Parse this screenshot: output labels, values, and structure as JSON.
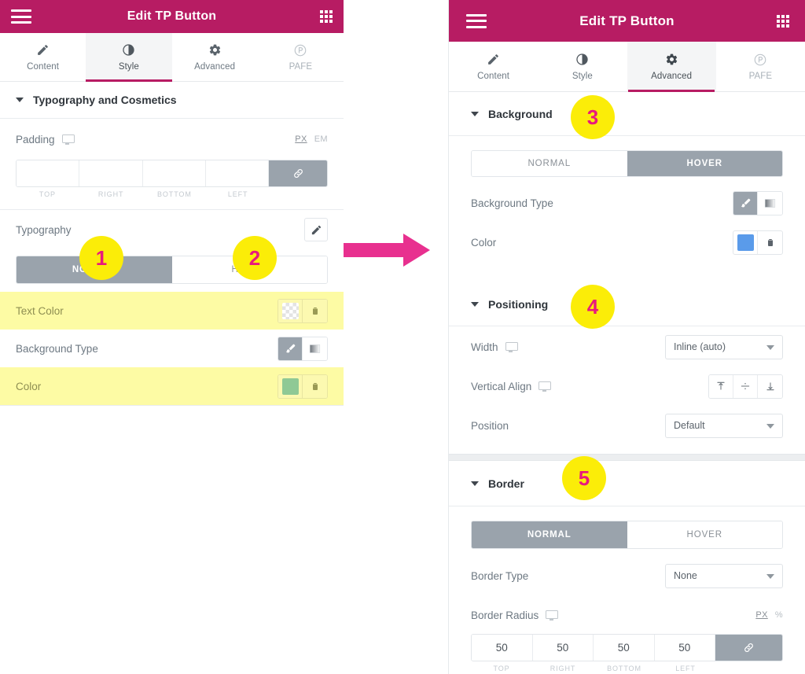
{
  "left_panel": {
    "titlebar": {
      "title": "Edit TP Button",
      "menu_icon": "hamburger-icon",
      "grid_icon": "apps-grid-icon"
    },
    "tabs": [
      {
        "label": "Content",
        "icon": "pencil-icon",
        "active": false
      },
      {
        "label": "Style",
        "icon": "contrast-icon",
        "active": true
      },
      {
        "label": "Advanced",
        "icon": "gear-icon",
        "active": false
      },
      {
        "label": "PAFE",
        "icon": "pafe-circle-p-icon",
        "active": false
      }
    ],
    "section": {
      "title": "Typography and Cosmetics"
    },
    "padding": {
      "label": "Padding",
      "units": [
        "PX",
        "EM"
      ],
      "active_unit": "PX",
      "values": [
        "",
        "",
        "",
        ""
      ],
      "captions": [
        "TOP",
        "RIGHT",
        "BOTTOM",
        "LEFT"
      ],
      "link_icon": "link-icon"
    },
    "typography": {
      "label": "Typography",
      "edit_icon": "pencil-edit-icon"
    },
    "state_toggle": {
      "options": [
        "NORMAL",
        "HOVER"
      ],
      "selected": "NORMAL"
    },
    "rows": [
      {
        "label": "Text Color",
        "control": "color",
        "swatch": "transparent",
        "reset_icon": "reset-icon",
        "highlighted": true
      },
      {
        "label": "Background Type",
        "control": "segmented",
        "options": [
          "classic-brush-icon",
          "gradient-icon"
        ],
        "selected": "classic-brush-icon",
        "highlighted": false
      },
      {
        "label": "Color",
        "control": "color",
        "swatch": "#8fc995",
        "reset_icon": "reset-icon",
        "highlighted": true
      }
    ]
  },
  "arrow": {
    "name": "flow-arrow",
    "color": "#e8308f"
  },
  "right_panel": {
    "titlebar": {
      "title": "Edit TP Button",
      "menu_icon": "hamburger-icon",
      "grid_icon": "apps-grid-icon"
    },
    "tabs": [
      {
        "label": "Content",
        "icon": "pencil-icon",
        "active": false
      },
      {
        "label": "Style",
        "icon": "contrast-icon",
        "active": false
      },
      {
        "label": "Advanced",
        "icon": "gear-icon",
        "active": true
      },
      {
        "label": "PAFE",
        "icon": "pafe-circle-p-icon",
        "active": false
      }
    ],
    "background_section": {
      "title": "Background",
      "badge": "3",
      "state_toggle": {
        "options": [
          "NORMAL",
          "HOVER"
        ],
        "selected": "HOVER"
      },
      "rows": [
        {
          "label": "Background Type",
          "control": "segmented",
          "options": [
            "classic-brush-icon",
            "gradient-icon"
          ],
          "selected": "classic-brush-icon"
        },
        {
          "label": "Color",
          "control": "color",
          "swatch": "#5a9bea",
          "reset_icon": "reset-icon"
        }
      ]
    },
    "positioning_section": {
      "title": "Positioning",
      "badge": "4",
      "width": {
        "label": "Width",
        "value": "Inline (auto)"
      },
      "vertical_align": {
        "label": "Vertical Align",
        "options": [
          "align-top-icon",
          "align-middle-icon",
          "align-bottom-icon"
        ],
        "selected": ""
      },
      "position": {
        "label": "Position",
        "value": "Default"
      }
    },
    "border_section": {
      "title": "Border",
      "badge": "5",
      "state_toggle": {
        "options": [
          "NORMAL",
          "HOVER"
        ],
        "selected": "NORMAL"
      },
      "border_type": {
        "label": "Border Type",
        "value": "None"
      },
      "border_radius": {
        "label": "Border Radius",
        "units": [
          "PX",
          "%"
        ],
        "active_unit": "PX",
        "values": [
          "50",
          "50",
          "50",
          "50"
        ],
        "captions": [
          "TOP",
          "RIGHT",
          "BOTTOM",
          "LEFT"
        ],
        "link_icon": "link-icon"
      }
    }
  },
  "badges": {
    "one": "1",
    "two": "2",
    "three": "3",
    "four": "4",
    "five": "5"
  },
  "colors": {
    "brand_magenta": "#b71c63",
    "badge_yellow": "#fbed08",
    "badge_text": "#e8197d",
    "highlight_yellow": "#fdfba4",
    "toggle_gray": "#9aa3ac",
    "arrow_pink": "#e8308f"
  }
}
